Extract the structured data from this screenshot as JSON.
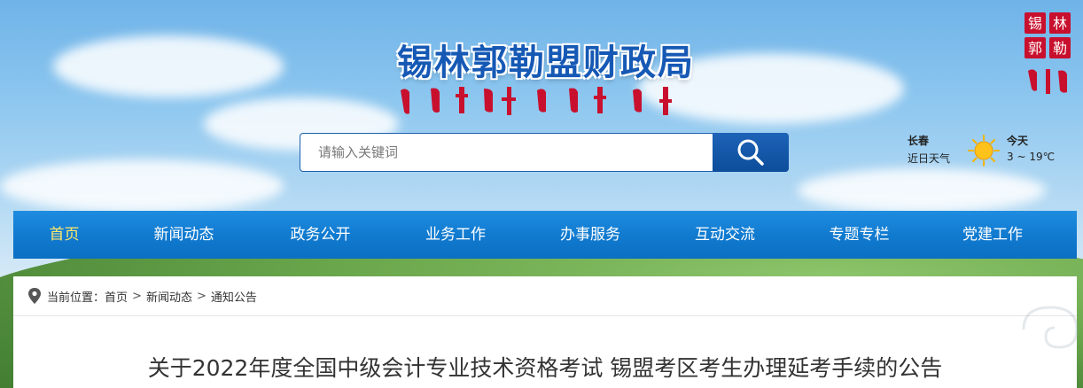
{
  "header": {
    "title": "锡林郭勒盟财政局",
    "logo_text": [
      "锡",
      "林",
      "郭",
      "勒"
    ]
  },
  "search": {
    "placeholder": "请输入关键词",
    "button_icon": "search-icon"
  },
  "weather": {
    "city": "长春",
    "recent_label": "近日天气",
    "icon": "sun-icon",
    "today_label": "今天",
    "temperature": "3 ~ 19℃"
  },
  "nav": {
    "items": [
      {
        "label": "首页",
        "active": true
      },
      {
        "label": "新闻动态",
        "active": false
      },
      {
        "label": "政务公开",
        "active": false
      },
      {
        "label": "业务工作",
        "active": false
      },
      {
        "label": "办事服务",
        "active": false
      },
      {
        "label": "互动交流",
        "active": false
      },
      {
        "label": "专题专栏",
        "active": false
      },
      {
        "label": "党建工作",
        "active": false
      }
    ]
  },
  "breadcrumb": {
    "prefix": "当前位置：",
    "items": [
      "首页",
      "新闻动态",
      "通知公告"
    ],
    "separator": ">"
  },
  "article": {
    "title": "关于2022年度全国中级会计专业技术资格考试 锡盟考区考生办理延考手续的公告"
  },
  "colors": {
    "nav_bg": "#117bd0",
    "nav_active": "#ffe86a",
    "title_blue": "#1659b5",
    "mongol_red": "#c8102e"
  }
}
